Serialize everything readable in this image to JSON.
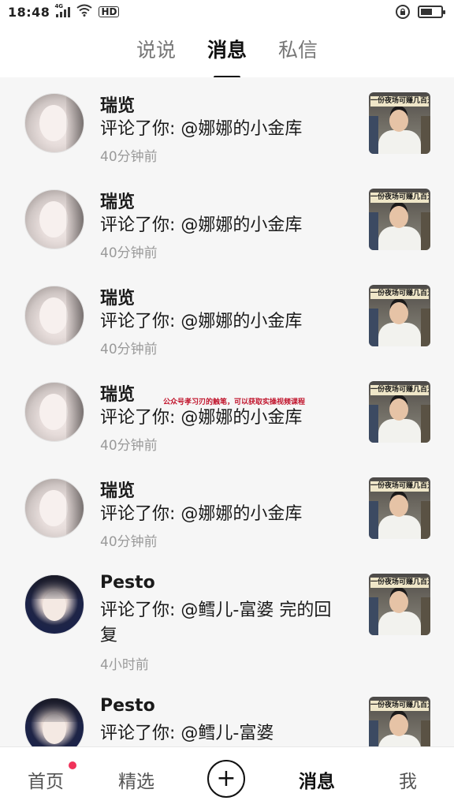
{
  "status_bar": {
    "time": "18:48",
    "network": "4G",
    "hd": "HD"
  },
  "top_tabs": [
    {
      "label": "说说",
      "active": false
    },
    {
      "label": "消息",
      "active": true
    },
    {
      "label": "私信",
      "active": false
    }
  ],
  "messages": [
    {
      "name": "瑞览",
      "comment": "评论了你: @娜娜的小金库",
      "time": "40分钟前",
      "avatar": "light",
      "thumb_text": "一份夜场可赚几百元"
    },
    {
      "name": "瑞览",
      "comment": "评论了你: @娜娜的小金库",
      "time": "40分钟前",
      "avatar": "light",
      "thumb_text": "一份夜场可赚几百元"
    },
    {
      "name": "瑞览",
      "comment": "评论了你: @娜娜的小金库",
      "time": "40分钟前",
      "avatar": "light",
      "thumb_text": "一份夜场可赚几百元"
    },
    {
      "name": "瑞览",
      "comment": "评论了你: @娜娜的小金库",
      "time": "40分钟前",
      "avatar": "light",
      "thumb_text": "一份夜场可赚几百元"
    },
    {
      "name": "瑞览",
      "comment": "评论了你: @娜娜的小金库",
      "time": "40分钟前",
      "avatar": "light",
      "thumb_text": "一份夜场可赚几百元"
    },
    {
      "name": "Pesto",
      "comment": "评论了你: @鳕儿-富婆 完的回复",
      "time": "4小时前",
      "avatar": "dark",
      "thumb_text": "一份夜场可赚几百元"
    },
    {
      "name": "Pesto",
      "comment": "评论了你: @鳕儿-富婆",
      "time": "",
      "avatar": "dark",
      "thumb_text": "一份夜场可赚几百元"
    }
  ],
  "watermark": "公众号孝习刃的触笔，可以获取实操视频课程",
  "bottom_nav": {
    "home": "首页",
    "featured": "精选",
    "plus": "+",
    "messages": "消息",
    "me": "我"
  },
  "colors": {
    "accent_dot": "#f0325a",
    "list_bg": "#f6f6f6"
  }
}
